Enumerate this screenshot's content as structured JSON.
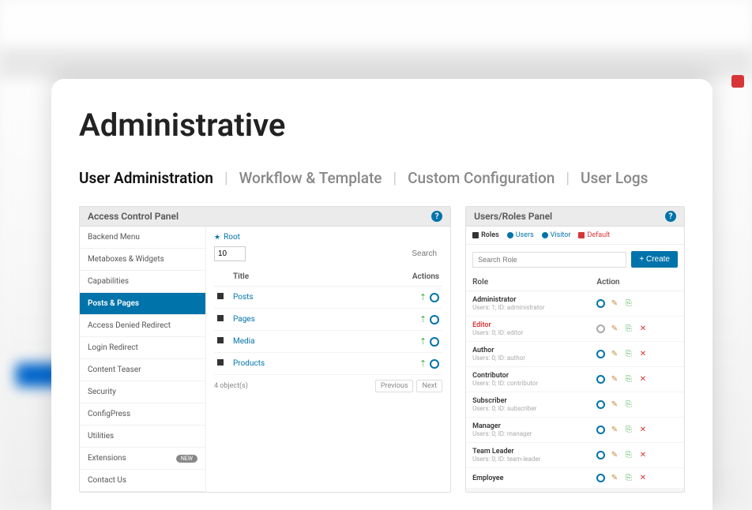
{
  "page": {
    "title": "Administrative"
  },
  "tabs": [
    {
      "label": "User Administration",
      "active": true
    },
    {
      "label": "Workflow & Template",
      "active": false
    },
    {
      "label": "Custom Configuration",
      "active": false
    },
    {
      "label": "User Logs",
      "active": false
    }
  ],
  "left_panel": {
    "title": "Access Control Panel",
    "sidebar": [
      {
        "label": "Backend Menu"
      },
      {
        "label": "Metaboxes & Widgets"
      },
      {
        "label": "Capabilities"
      },
      {
        "label": "Posts & Pages",
        "active": true
      },
      {
        "label": "Access Denied Redirect"
      },
      {
        "label": "Login Redirect"
      },
      {
        "label": "Content Teaser"
      },
      {
        "label": "Security"
      },
      {
        "label": "ConfigPress"
      },
      {
        "label": "Utilities"
      },
      {
        "label": "Extensions",
        "badge": "NEW"
      },
      {
        "label": "Contact Us"
      }
    ],
    "crumb": "Root",
    "select_value": "10",
    "search_placeholder": "Search",
    "columns": {
      "title": "Title",
      "actions": "Actions"
    },
    "rows": [
      {
        "title": "Posts"
      },
      {
        "title": "Pages"
      },
      {
        "title": "Media"
      },
      {
        "title": "Products"
      }
    ],
    "footer_count": "4 object(s)",
    "pager": {
      "prev": "Previous",
      "next": "Next"
    }
  },
  "right_panel": {
    "title": "Users/Roles Panel",
    "tabs": {
      "roles": "Roles",
      "users": "Users",
      "visitor": "Visitor",
      "default": "Default"
    },
    "search_placeholder": "Search Role",
    "create_label": "+ Create",
    "columns": {
      "role": "Role",
      "action": "Action"
    },
    "roles": [
      {
        "name": "Administrator",
        "sub": "Users: 1; ID: administrator",
        "editor": false,
        "gray": false,
        "delete": false
      },
      {
        "name": "Editor",
        "sub": "Users: 0; ID: editor",
        "editor": true,
        "gray": true,
        "delete": true
      },
      {
        "name": "Author",
        "sub": "Users: 0; ID: author",
        "editor": false,
        "gray": false,
        "delete": true
      },
      {
        "name": "Contributor",
        "sub": "Users: 0; ID: contributor",
        "editor": false,
        "gray": false,
        "delete": true
      },
      {
        "name": "Subscriber",
        "sub": "Users: 0; ID: subscriber",
        "editor": false,
        "gray": false,
        "delete": false
      },
      {
        "name": "Manager",
        "sub": "Users: 0; ID: manager",
        "editor": false,
        "gray": false,
        "delete": true
      },
      {
        "name": "Team Leader",
        "sub": "Users: 0; ID: team-leader",
        "editor": false,
        "gray": false,
        "delete": true
      },
      {
        "name": "Employee",
        "sub": "",
        "editor": false,
        "gray": false,
        "delete": true
      }
    ]
  }
}
